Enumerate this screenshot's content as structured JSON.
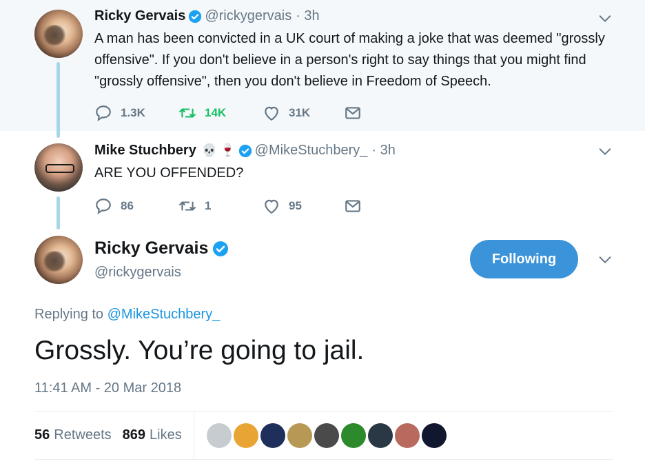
{
  "tweet1": {
    "name": "Ricky Gervais",
    "handle": "@rickygervais",
    "time": "· 3h",
    "text": "A man has been convicted in a UK court of making a joke that was deemed \"grossly offensive\". If you don't believe in a person's right to say things that you might find \"grossly offensive\", then you don't believe in Freedom of Speech.",
    "replies": "1.3K",
    "retweets": "14K",
    "likes": "31K"
  },
  "tweet2": {
    "name": "Mike Stuchbery",
    "emojis": [
      "💀",
      "🍷"
    ],
    "handle": "@MikeStuchbery_",
    "time": "· 3h",
    "text": "ARE YOU OFFENDED?",
    "replies": "86",
    "retweets": "1",
    "likes": "95"
  },
  "main": {
    "name": "Ricky Gervais",
    "handle": "@rickygervais",
    "follow_label": "Following",
    "replying_prefix": "Replying to ",
    "replying_to": "@MikeStuchbery_",
    "text": "Grossly. You’re going to jail.",
    "timestamp": "11:41 AM - 20 Mar 2018",
    "retweet_count": "56",
    "retweet_label": "Retweets",
    "like_count": "869",
    "like_label": "Likes"
  },
  "likers": [
    {
      "color": "#c7ccd1"
    },
    {
      "color": "#e8a534"
    },
    {
      "color": "#1f2f5c"
    },
    {
      "color": "#b79854"
    },
    {
      "color": "#4a4a4a"
    },
    {
      "color": "#2c8a2c"
    },
    {
      "color": "#2a3845"
    },
    {
      "color": "#b86a5e"
    },
    {
      "color": "#10172e"
    }
  ],
  "colors": {
    "verified": "#1da1f2",
    "accent": "#1b95e0",
    "retweet_active": "#17bf63",
    "follow_button": "#3b94d9"
  },
  "icons": [
    "reply-icon",
    "retweet-icon",
    "like-icon",
    "direct-message-icon",
    "chevron-down-icon",
    "verified-badge-icon"
  ]
}
